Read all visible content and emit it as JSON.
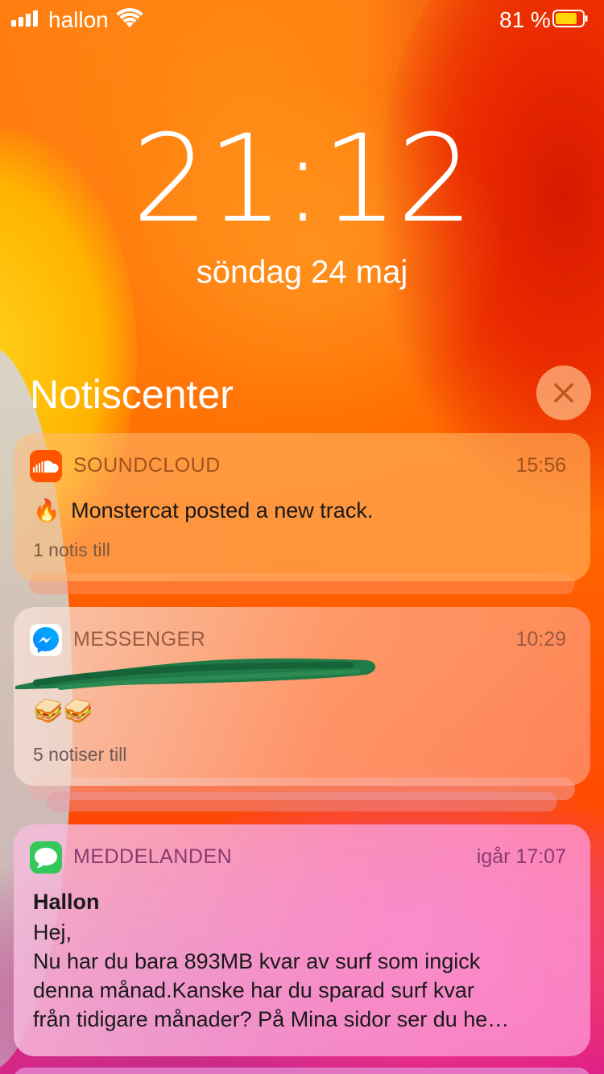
{
  "status_bar": {
    "carrier": "hallon",
    "battery_percent": "81 %",
    "battery_level": 0.81,
    "icons": [
      "signal-bars-icon",
      "wifi-icon",
      "battery-icon"
    ]
  },
  "lock_screen": {
    "time": "21:12",
    "date": "söndag 24 maj"
  },
  "notification_center": {
    "title": "Notiscenter",
    "close_icon": "close-x-icon"
  },
  "notifications": [
    {
      "app": "SOUNDCLOUD",
      "icon": "soundcloud-icon",
      "time": "15:56",
      "emoji": "🔥",
      "text": "Monstercat posted a new track.",
      "more": "1 notis till"
    },
    {
      "app": "MESSENGER",
      "icon": "messenger-icon",
      "time": "10:29",
      "redacted_line": true,
      "emoji": "🥪🥪",
      "more": "5 notiser till"
    },
    {
      "app": "MEDDELANDEN",
      "icon": "messages-icon",
      "time": "igår 17:07",
      "sender": "Hallon",
      "lines": [
        "Hej,",
        "Nu har du bara 893MB kvar av surf som ingick",
        "denna månad.Kanske har du sparad surf kvar",
        "från tidigare månader? På Mina sidor ser du he…"
      ]
    }
  ],
  "colors": {
    "wallpaper_orange": "#ff6a00",
    "soundcloud_orange": "#ff5500",
    "messenger_blue": "#0a84ff",
    "messages_green": "#34c759",
    "redaction_green": "#1f7a45"
  }
}
